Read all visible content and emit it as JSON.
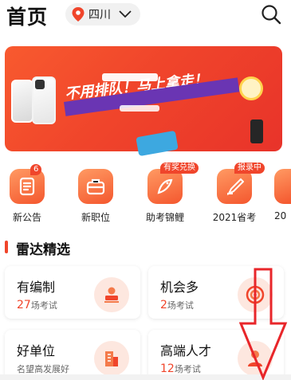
{
  "header": {
    "title": "首页",
    "location": "四川",
    "icons": {
      "location": "location-pin-icon",
      "dropdown": "chevron-down-icon",
      "search": "search-icon"
    }
  },
  "banner": {
    "headline": "不用排队！马上拿走！",
    "colors": {
      "primary": "#f0452b",
      "ribbon": "#6a35b3"
    }
  },
  "quick_entries": [
    {
      "label": "新公告",
      "badge": "6",
      "icon": "announcement-icon"
    },
    {
      "label": "新职位",
      "badge": "",
      "icon": "briefcase-icon"
    },
    {
      "label": "助考锦鲤",
      "badge": "有奖兑换",
      "icon": "koi-fish-icon"
    },
    {
      "label": "2021省考",
      "badge": "报录中",
      "icon": "pen-nib-icon"
    },
    {
      "label": "20",
      "badge": "",
      "icon": "more-icon"
    }
  ],
  "section": {
    "title": "雷达精选"
  },
  "cards": [
    {
      "title": "有编制",
      "count": "27",
      "unit": "场考试",
      "icon": "stamp-icon"
    },
    {
      "title": "机会多",
      "count": "2",
      "unit": "场考试",
      "icon": "target-icon"
    },
    {
      "title": "好单位",
      "subtitle": "名望高发展好",
      "icon": "building-icon"
    },
    {
      "title": "高端人才",
      "count": "12",
      "unit": "场考试",
      "icon": "talent-icon"
    }
  ],
  "accent_color": "#f0452b"
}
